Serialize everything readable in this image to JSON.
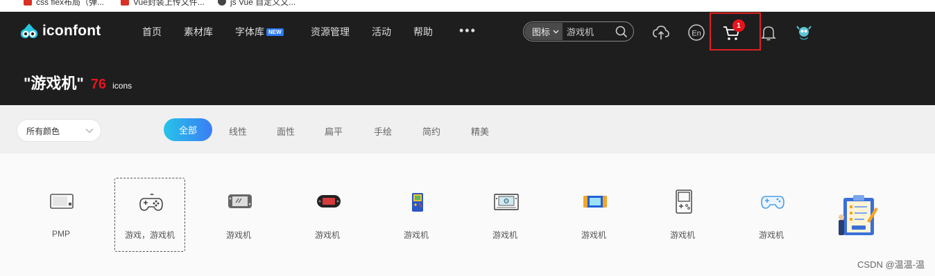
{
  "bookmarks": [
    {
      "label": "css flex布局（弹...",
      "color": "#d93025"
    },
    {
      "label": "Vue封装上传文件...",
      "color": "#d93025"
    },
    {
      "label": "js Vue 自定义文...",
      "color": "#444444"
    }
  ],
  "header": {
    "logo_text": "iconfont",
    "nav": [
      "首页",
      "素材库",
      "字体库",
      "资源管理",
      "活动",
      "帮助"
    ],
    "nav_badge": "NEW",
    "more": "•••",
    "search_type": "图标",
    "search_value": "游戏机",
    "cart_count": "1"
  },
  "result": {
    "query": "\"游戏机\"",
    "count": "76",
    "unit": "icons"
  },
  "filters": {
    "color_select": "所有颜色",
    "tabs": [
      "全部",
      "线性",
      "面性",
      "扁平",
      "手绘",
      "简约",
      "精美"
    ]
  },
  "icons": [
    {
      "label": "PMP",
      "icon": "pmp-icon"
    },
    {
      "label": "游戏，游戏机",
      "icon": "gamepad-icon"
    },
    {
      "label": "游戏机",
      "icon": "switch-icon"
    },
    {
      "label": "游戏机",
      "icon": "handheld-black-icon"
    },
    {
      "label": "游戏机",
      "icon": "gameboy-color-icon"
    },
    {
      "label": "游戏机",
      "icon": "arcade-screen-icon"
    },
    {
      "label": "游戏机",
      "icon": "handheld-blue-icon"
    },
    {
      "label": "游戏机",
      "icon": "gameboy-outline-icon"
    },
    {
      "label": "游戏机",
      "icon": "controller-blue-icon"
    },
    {
      "label": "",
      "icon": "clipboard-illustration-icon"
    }
  ],
  "watermark": "CSDN @温温-温",
  "colors": {
    "header_bg": "#1e1e1e",
    "accent_red": "#e8141c",
    "tab_gradient_start": "#27c4e8",
    "tab_gradient_end": "#3a7df5"
  }
}
